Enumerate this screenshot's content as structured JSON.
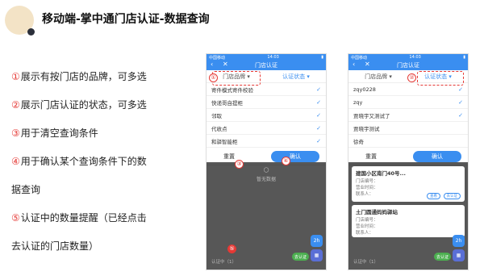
{
  "slide": {
    "title": "移动端-掌中通门店认证-数据查询",
    "bullets": [
      {
        "num": "①",
        "text": "展示有按门店的品牌，可多选"
      },
      {
        "num": "②",
        "text": "展示门店认证的状态，可多选"
      },
      {
        "num": "③",
        "text": "用于清空查询条件"
      },
      {
        "num": "④",
        "text": "用于确认某个查询条件下的数"
      },
      {
        "num": "",
        "text": "据查询"
      },
      {
        "num": "⑤",
        "text": "认证中的数量提醒（已经点击"
      },
      {
        "num": "",
        "text": "去认证的门店数量）"
      }
    ]
  },
  "phone1": {
    "carrier": "中国移动",
    "time": "14:03",
    "nav_title": "门店认证",
    "filter_brand": "门店品牌",
    "filter_status": "认证状态",
    "items": [
      "寄件模式寄件校验",
      "快递哥自提柜",
      "邻取",
      "代收点",
      "和驿智能柜"
    ],
    "reset": "重置",
    "confirm": "确认",
    "empty_text": "暂无数据",
    "bottom_text": "认证中（1）",
    "float": "2h",
    "auth_label": "去认证",
    "markers": [
      "①",
      "③",
      "④",
      "⑤"
    ]
  },
  "phone2": {
    "carrier": "中国移动",
    "time": "14:03",
    "nav_title": "门店认证",
    "filter_brand": "门店品牌",
    "filter_status": "认证状态",
    "items": [
      "zqy0228",
      "zqy",
      "贾晓宇又测试了",
      "贾晓宇测试",
      "徐奇"
    ],
    "reset": "重置",
    "confirm": "确认",
    "card1_name": "建国小区南门40号...",
    "card1_l1": "门店编号：",
    "card1_l2": "营业时间：",
    "card1_l3": "联系人：",
    "card1_btn1": "查看",
    "card1_btn2": "去认证",
    "card2_name": "土门圆通妈妈驿站",
    "card2_l1": "门店编号：",
    "card2_l2": "营业时间：",
    "card2_l3": "联系人：",
    "bottom_text": "认证中（1）",
    "float": "2h",
    "auth_label": "去认证",
    "marker": "②"
  },
  "colors": {
    "accent": "#3a8ef0",
    "marker_red": "#e53935",
    "auth_green": "#4caf50"
  }
}
